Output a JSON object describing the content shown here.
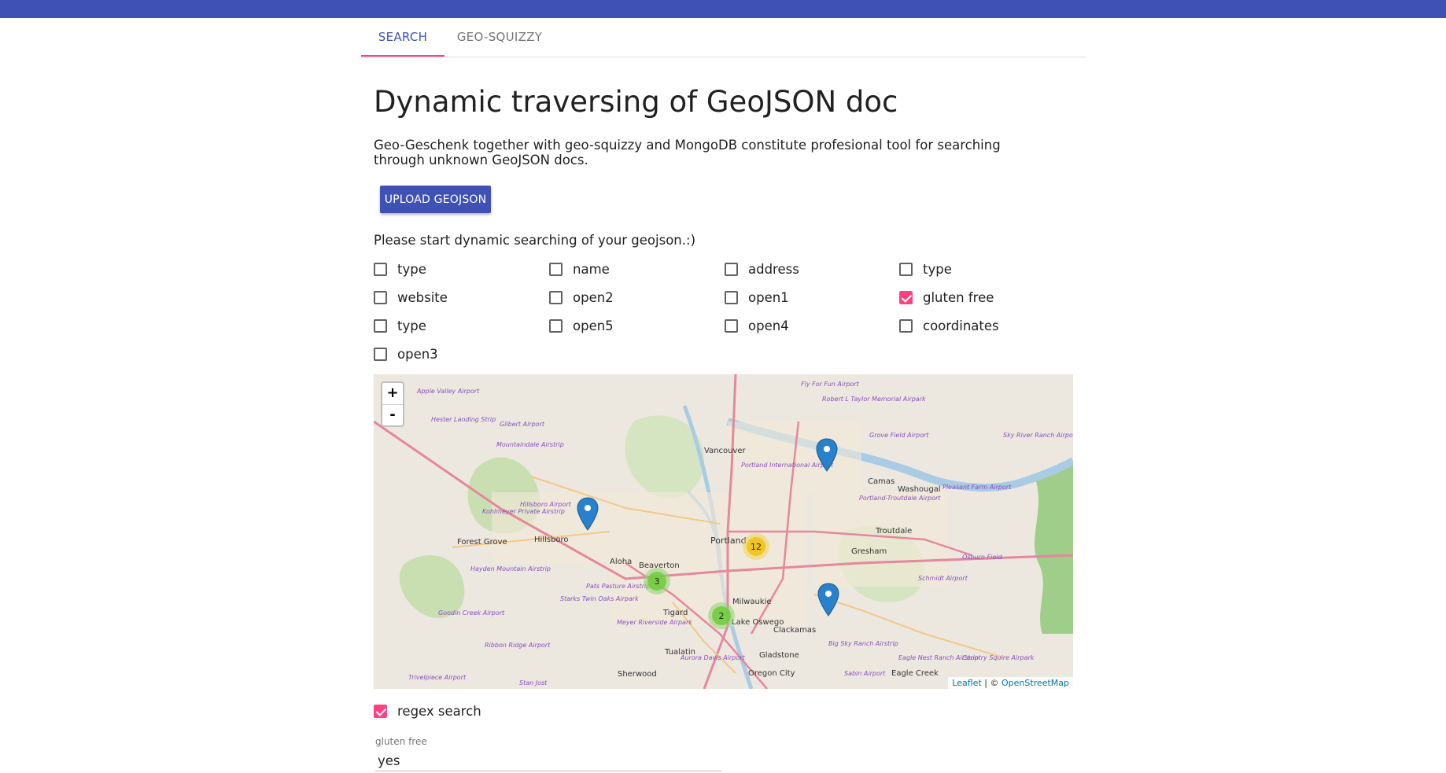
{
  "tabs": [
    {
      "label": "SEARCH",
      "active": true
    },
    {
      "label": "GEO-SQUIZZY",
      "active": false
    }
  ],
  "colors": {
    "primary": "#3f51b5",
    "accent": "#ff4081"
  },
  "page": {
    "title": "Dynamic traversing of GeoJSON doc",
    "description": "Geo-Geschenk together with geo-squizzy and MongoDB constitute profesional tool for searching through unknown GeoJSON docs.",
    "upload_label": "UPLOAD GEOJSON",
    "prompt": "Please start dynamic searching of your geojson.:)"
  },
  "fields": [
    {
      "label": "type",
      "checked": false
    },
    {
      "label": "name",
      "checked": false
    },
    {
      "label": "address",
      "checked": false
    },
    {
      "label": "type",
      "checked": false
    },
    {
      "label": "website",
      "checked": false
    },
    {
      "label": "open2",
      "checked": false
    },
    {
      "label": "open1",
      "checked": false
    },
    {
      "label": "gluten free",
      "checked": true
    },
    {
      "label": "type",
      "checked": false
    },
    {
      "label": "open5",
      "checked": false
    },
    {
      "label": "open4",
      "checked": false
    },
    {
      "label": "coordinates",
      "checked": false
    },
    {
      "label": "open3",
      "checked": false
    }
  ],
  "map": {
    "zoom_in": "+",
    "zoom_out": "-",
    "attribution_leaflet": "Leaflet",
    "attribution_sep": " | © ",
    "attribution_osm": "OpenStreetMap",
    "cities": [
      "Vancouver",
      "Portland",
      "Hillsboro",
      "Forest Grove",
      "Beaverton",
      "Aloha",
      "Tigard",
      "Milwaukie",
      "Gresham",
      "Troutdale",
      "Camas",
      "Washougal",
      "Clackamas",
      "Gladstone",
      "Oregon City",
      "Tualatin",
      "Sherwood",
      "Eagle Creek",
      "Lake Oswego"
    ],
    "airports": [
      "Apple Valley Airport",
      "Hester Landing Strip",
      "Gilbert Airport",
      "Mountaindale Airstrip",
      "Fly For Fun Airport",
      "Robert L Taylor Memorial Airpark",
      "Grove Field Airport",
      "Sky River Ranch Airport",
      "Portland International Airport",
      "Pleasant Farm Airport",
      "Portland-Troutdale Airport",
      "Kohlmeyer Private Airstrip",
      "Hillsboro Airport",
      "Hayden Mountain Airstrip",
      "Pats Pasture Airstrip",
      "Starks Twin Oaks Airpark",
      "Goodin Creek Airport",
      "Meyer Riverside Airpark",
      "Osburn Field",
      "Schmidt Airport",
      "Ribbon Ridge Airport",
      "Aurora Davis Airport",
      "Big Sky Ranch Airstrip",
      "Eagle Nest Ranch Airstrip",
      "Country Squire Airpark",
      "Sabin Airport",
      "Trivelpiece Airport",
      "Stan Jost"
    ],
    "clusters": [
      {
        "count": "12",
        "lat": 45.515,
        "lon": -122.63,
        "color": "#f1d357"
      },
      {
        "count": "3",
        "lat": 45.485,
        "lon": -122.79,
        "color": "#8fd16f"
      },
      {
        "count": "2",
        "lat": 45.445,
        "lon": -122.69,
        "color": "#8fd16f"
      }
    ],
    "markers": [
      {
        "lat": 45.6,
        "lon": -122.5
      },
      {
        "lat": 45.55,
        "lon": -122.9
      },
      {
        "lat": 45.45,
        "lon": -122.5
      }
    ]
  },
  "regex": {
    "label": "regex search",
    "checked": true
  },
  "search_field": {
    "label": "gluten free",
    "value": "yes"
  }
}
